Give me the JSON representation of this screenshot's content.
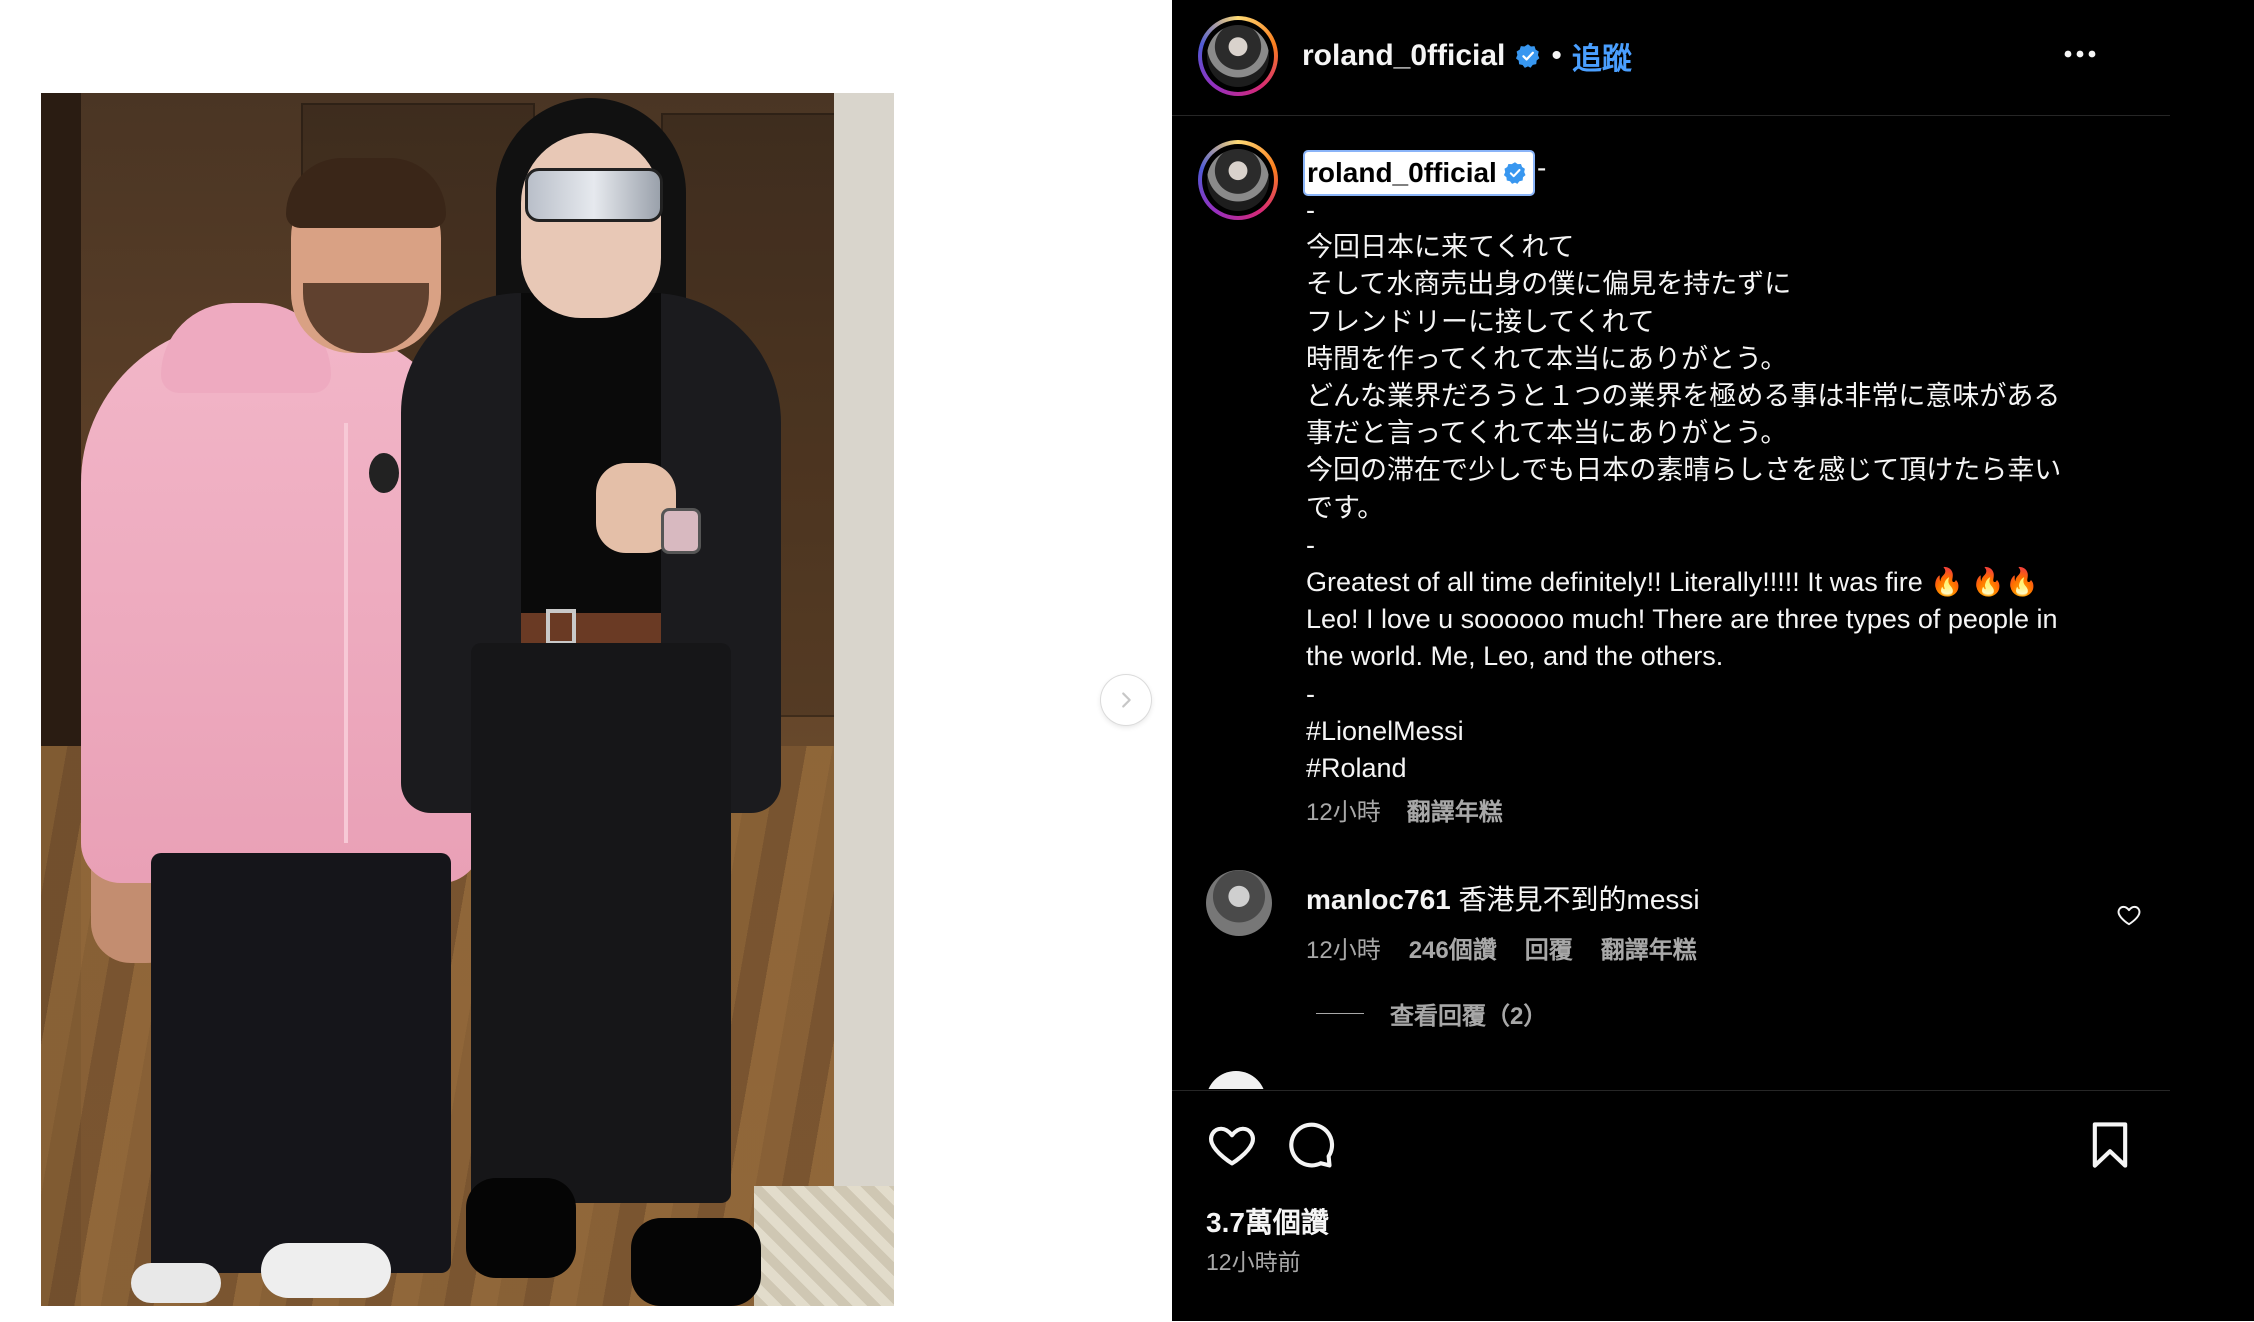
{
  "post": {
    "username": "roland_0fficial",
    "separator": "•",
    "follow_label": "追蹤"
  },
  "caption": {
    "username": "roland_0fficial",
    "trailing": "-",
    "lines": [
      "-",
      "今回日本に来てくれて",
      "そして水商売出身の僕に偏見を持たずに",
      "フレンドリーに接してくれて",
      "時間を作ってくれて本当にありがとう。",
      "どんな業界だろうと１つの業界を極める事は非常に意味がある",
      "事だと言ってくれて本当にありがとう。",
      "今回の滞在で少しでも日本の素晴らしさを感じて頂けたら幸い",
      "です。",
      "-",
      "Greatest of all time definitely!! Literally!!!!! It was fire 🔥 🔥🔥",
      "Leo! I love u soooooo much! There are three types of people in",
      "the world. Me, Leo, and the others.",
      "-",
      "#LionelMessi",
      "#Roland"
    ],
    "time": "12小時",
    "translate": "翻譯年糕"
  },
  "comment": {
    "username": "manloc761",
    "text": "香港見不到的messi",
    "time": "12小時",
    "likes": "246個讚",
    "reply": "回覆",
    "translate": "翻譯年糕",
    "view_replies": "查看回覆（2）"
  },
  "footer": {
    "likes": "3.7萬個讚",
    "timestamp": "12小時前"
  },
  "icons": {
    "verified": "verified-badge-icon",
    "more": "more-horizontal-icon",
    "next": "chevron-right-icon",
    "like": "heart-icon",
    "comment": "comment-bubble-icon",
    "save": "bookmark-icon"
  },
  "colors": {
    "link_blue": "#4a9fff",
    "verified_blue": "#3897f0",
    "panel_bg": "#000000",
    "muted_text": "#a8a8a8"
  }
}
